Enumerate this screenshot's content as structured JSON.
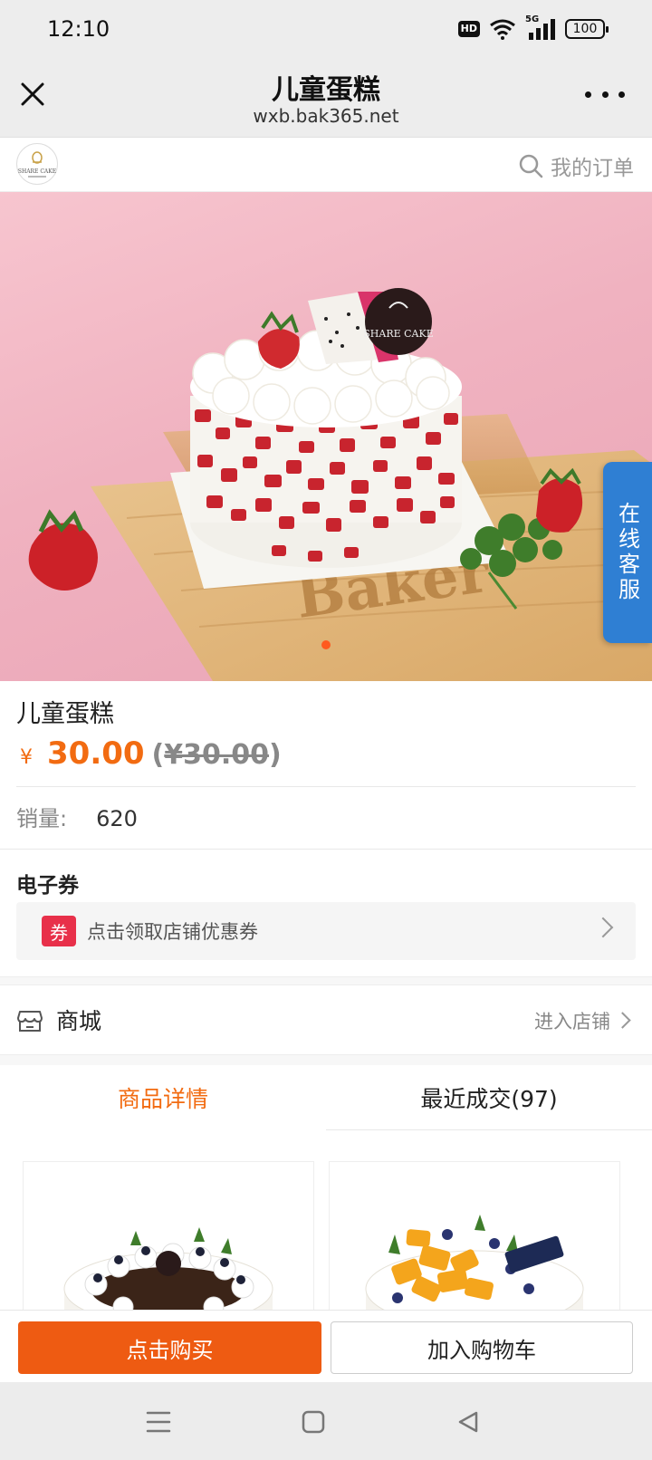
{
  "status_bar": {
    "time": "12:10",
    "hd": "HD",
    "network": "5G",
    "battery": "100"
  },
  "title_bar": {
    "title": "儿童蛋糕",
    "url": "wxb.bak365.net"
  },
  "shop_header": {
    "logo_text": "SHARE CAKE",
    "orders_label": "我的订单"
  },
  "banner": {
    "plaque_text": "SHARE CAKE",
    "board_text": "Baker",
    "chat_label": "在线客服"
  },
  "product": {
    "name": "儿童蛋糕",
    "currency": "¥",
    "price": "30.00",
    "original_price": "¥30.00",
    "sales_label": "销量:",
    "sales_value": "620"
  },
  "coupon": {
    "title": "电子券",
    "tag": "券",
    "text": "点击领取店铺优惠券"
  },
  "store": {
    "label": "商城",
    "enter_label": "进入店铺"
  },
  "tabs": [
    {
      "label": "商品详情",
      "active": true
    },
    {
      "label": "最近成交(97)",
      "active": false
    }
  ],
  "actions": {
    "buy_label": "点击购买",
    "cart_label": "加入购物车"
  },
  "colors": {
    "accent": "#f26b11",
    "buy_button": "#ee5b12",
    "chat_tab": "#2f7fd3",
    "coupon_tag": "#e8304a"
  }
}
